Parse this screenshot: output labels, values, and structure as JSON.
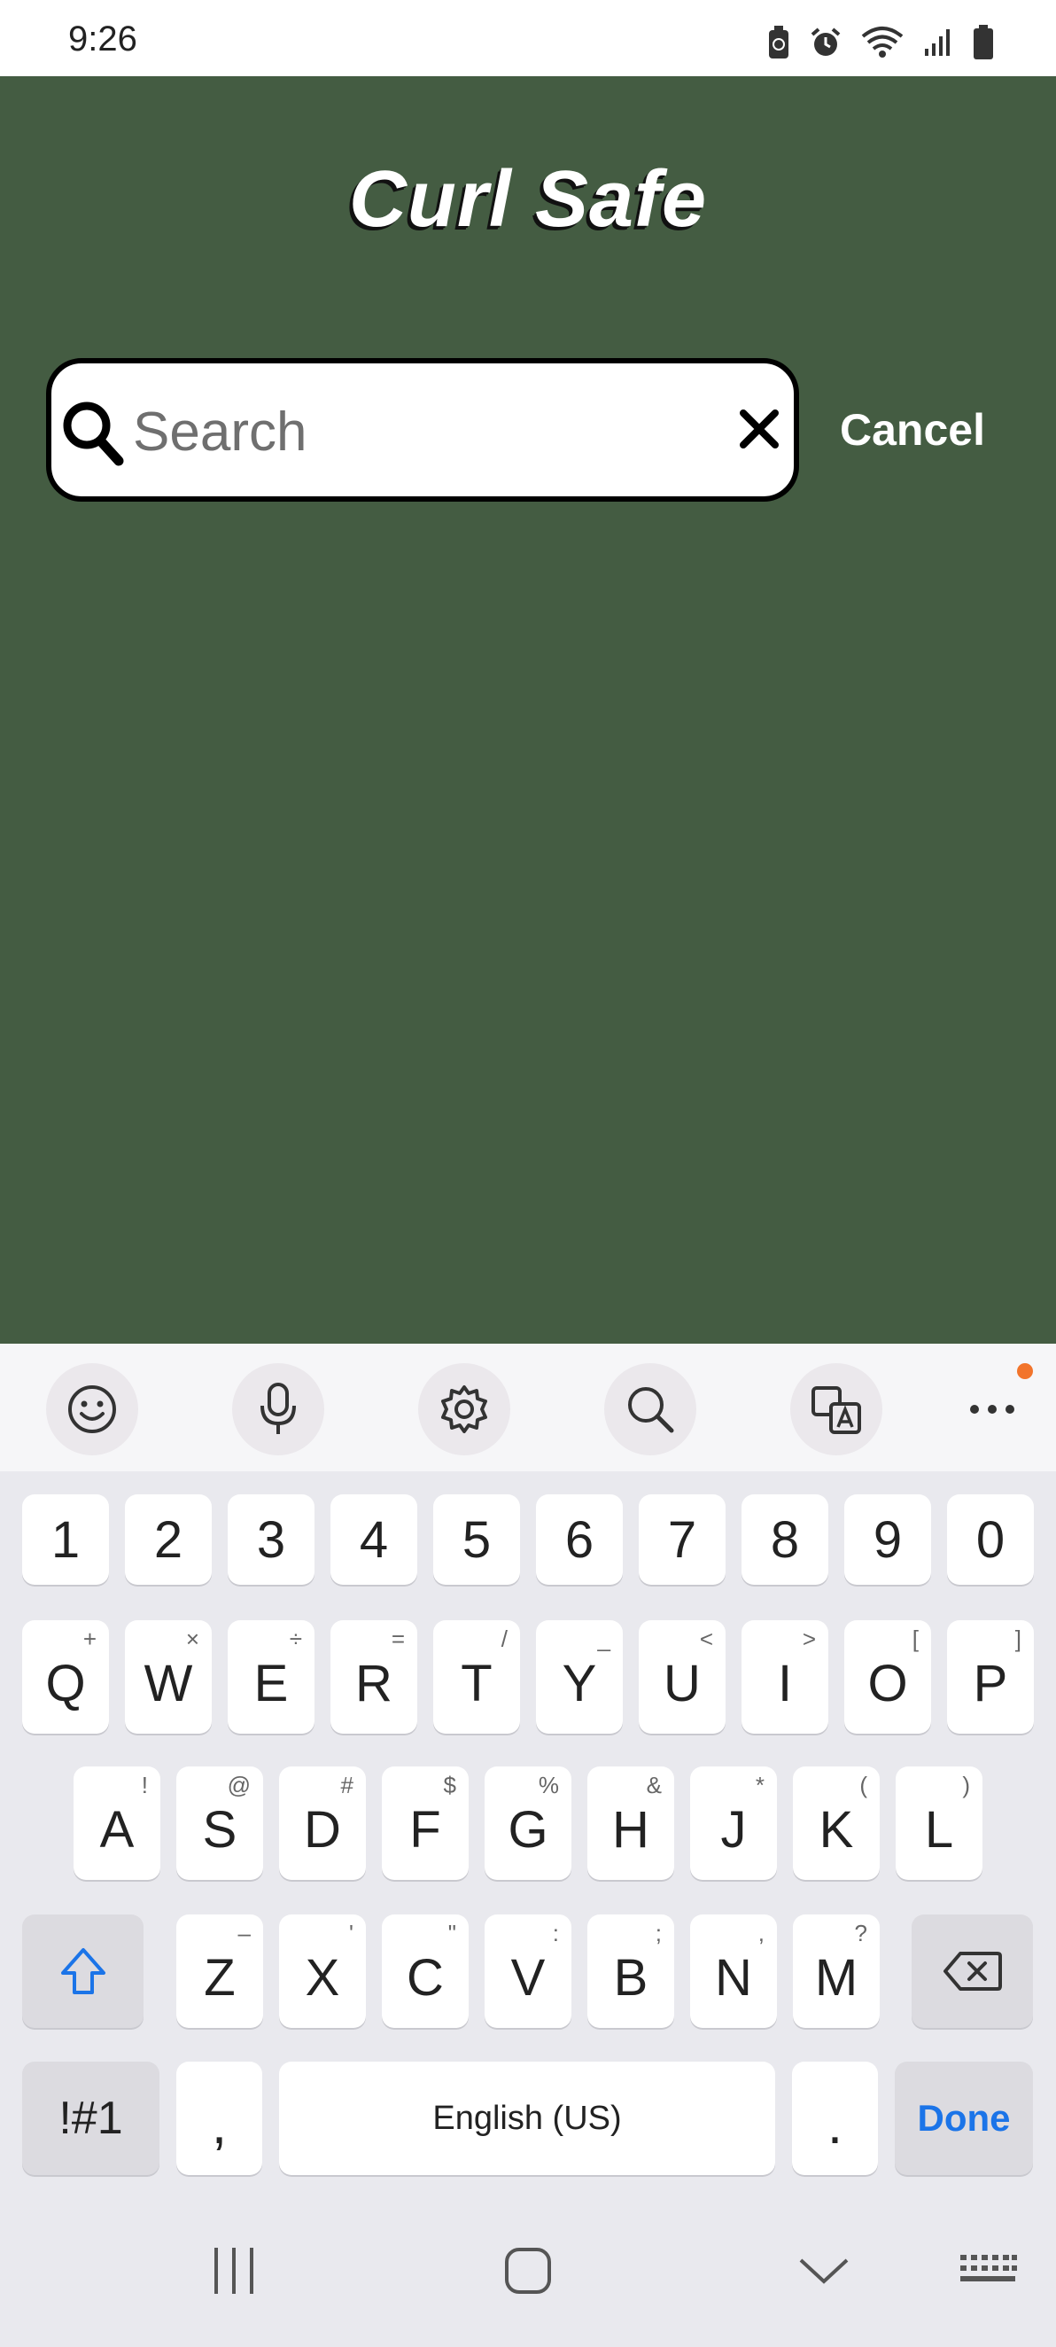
{
  "status": {
    "time": "9:26"
  },
  "app": {
    "title": "Curl Safe",
    "search": {
      "placeholder": "Search",
      "value": ""
    },
    "cancel_label": "Cancel",
    "colors": {
      "background": "#445c42",
      "title_shadow": "#111111"
    }
  },
  "keyboard": {
    "toolbar": [
      "emoji-icon",
      "microphone-icon",
      "gear-icon",
      "search-icon",
      "translate-icon",
      "more-icon"
    ],
    "number_row": [
      "1",
      "2",
      "3",
      "4",
      "5",
      "6",
      "7",
      "8",
      "9",
      "0"
    ],
    "row1": [
      {
        "key": "Q",
        "hint": "+"
      },
      {
        "key": "W",
        "hint": "×"
      },
      {
        "key": "E",
        "hint": "÷"
      },
      {
        "key": "R",
        "hint": "="
      },
      {
        "key": "T",
        "hint": "/"
      },
      {
        "key": "Y",
        "hint": "_"
      },
      {
        "key": "U",
        "hint": "<"
      },
      {
        "key": "I",
        "hint": ">"
      },
      {
        "key": "O",
        "hint": "["
      },
      {
        "key": "P",
        "hint": "]"
      }
    ],
    "row2": [
      {
        "key": "A",
        "hint": "!"
      },
      {
        "key": "S",
        "hint": "@"
      },
      {
        "key": "D",
        "hint": "#"
      },
      {
        "key": "F",
        "hint": "$"
      },
      {
        "key": "G",
        "hint": "%"
      },
      {
        "key": "H",
        "hint": "&"
      },
      {
        "key": "J",
        "hint": "*"
      },
      {
        "key": "K",
        "hint": "("
      },
      {
        "key": "L",
        "hint": ")"
      }
    ],
    "row3": [
      {
        "key": "Z",
        "hint": "–"
      },
      {
        "key": "X",
        "hint": "'"
      },
      {
        "key": "C",
        "hint": "\""
      },
      {
        "key": "V",
        "hint": ":"
      },
      {
        "key": "B",
        "hint": ";"
      },
      {
        "key": "N",
        "hint": ","
      },
      {
        "key": "M",
        "hint": "?"
      }
    ],
    "symbols_label": "!#1",
    "comma_label": ",",
    "space_label": "English (US)",
    "period_label": ".",
    "done_label": "Done",
    "colors": {
      "accent": "#1b74e8",
      "notification": "#f2742b"
    }
  },
  "nav": [
    "recent-apps-icon",
    "home-icon",
    "back-icon",
    "keyboard-icon"
  ]
}
